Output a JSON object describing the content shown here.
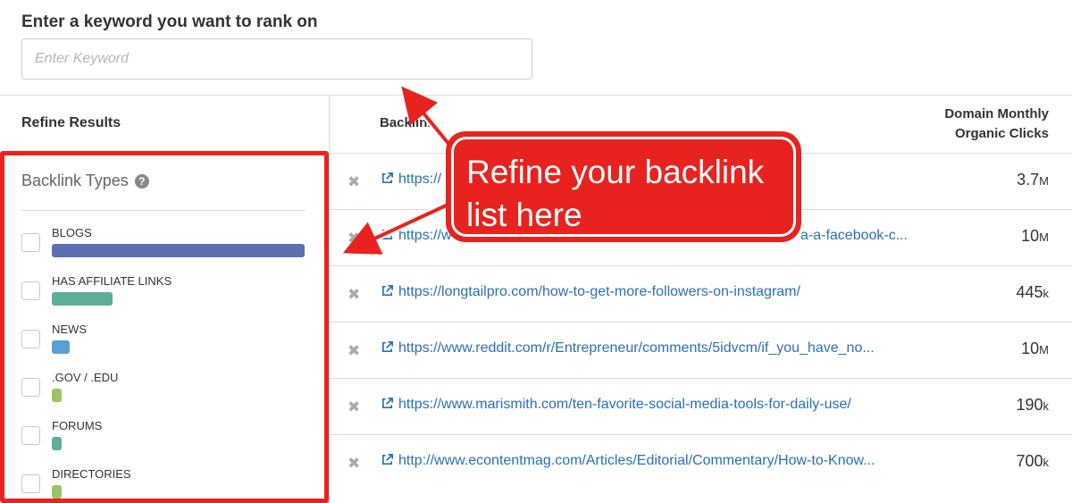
{
  "keyword": {
    "label": "Enter a keyword you want to rank on",
    "placeholder": "Enter Keyword"
  },
  "sidebar": {
    "title": "Refine Results",
    "backlink_types_title": "Backlink Types",
    "types": [
      {
        "label": "BLOGS",
        "share": 1.0,
        "color": "#5b6fb3"
      },
      {
        "label": "HAS AFFILIATE LINKS",
        "share": 0.24,
        "color": "#5fae97"
      },
      {
        "label": "NEWS",
        "share": 0.07,
        "color": "#5aa0d4"
      },
      {
        "label": ".GOV / .EDU",
        "share": 0.04,
        "color": "#9ac464"
      },
      {
        "label": "FORUMS",
        "share": 0.04,
        "color": "#5fae97"
      },
      {
        "label": "DIRECTORIES",
        "share": 0.04,
        "color": "#9ac464"
      }
    ]
  },
  "table": {
    "col_backlink": "Backlink",
    "col_clicks_line1": "Domain Monthly",
    "col_clicks_line2": "Organic Clicks",
    "rows": [
      {
        "url": "https://",
        "value": "3.7",
        "unit": "M"
      },
      {
        "url": "https://w",
        "url_tail": "a-a-facebook-c...",
        "value": "10",
        "unit": "M"
      },
      {
        "url": "https://longtailpro.com/how-to-get-more-followers-on-instagram/",
        "value": "445",
        "unit": "k"
      },
      {
        "url": "https://www.reddit.com/r/Entrepreneur/comments/5idvcm/if_you_have_no...",
        "value": "10",
        "unit": "M"
      },
      {
        "url": "https://www.marismith.com/ten-favorite-social-media-tools-for-daily-use/",
        "value": "190",
        "unit": "k"
      },
      {
        "url": "http://www.econtentmag.com/Articles/Editorial/Commentary/How-to-Know...",
        "value": "700",
        "unit": "k"
      }
    ]
  },
  "callout": {
    "text": "Refine your backlink\nlist here",
    "color": "#e8231f"
  },
  "icons": {
    "remove": "close-x-icon",
    "external": "external-link-icon",
    "help": "help-icon"
  }
}
